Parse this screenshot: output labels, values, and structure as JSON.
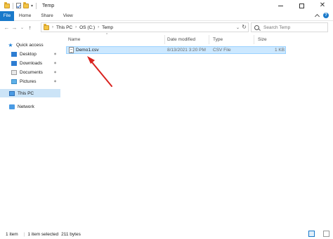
{
  "window": {
    "title": "Temp",
    "controls": {
      "minimize": "—",
      "maximize": "□",
      "close": "✕"
    }
  },
  "quick_access_toolbar": {
    "dropdown": "▾"
  },
  "ribbon": {
    "tabs": [
      "File",
      "Home",
      "Share",
      "View"
    ],
    "collapse_icon": "chevron-up-icon",
    "help_glyph": "?"
  },
  "navigation": {
    "back": "←",
    "forward": "→",
    "recent": "⌄",
    "up": "↑",
    "breadcrumb": [
      "This PC",
      "OS (C:)",
      "Temp"
    ],
    "separator": "›",
    "address_dropdown": "⌄",
    "refresh": "↻",
    "search_placeholder": "Search Temp"
  },
  "sidebar": {
    "quick_access": "Quick access",
    "items": [
      {
        "label": "Desktop",
        "icon": "desktop-icon",
        "pinned": true
      },
      {
        "label": "Downloads",
        "icon": "downloads-icon",
        "pinned": true
      },
      {
        "label": "Documents",
        "icon": "documents-icon",
        "pinned": true
      },
      {
        "label": "Pictures",
        "icon": "pictures-icon",
        "pinned": true
      }
    ],
    "this_pc": "This PC",
    "network": "Network",
    "pin_glyph": "✶"
  },
  "file_list": {
    "columns": [
      "Name",
      "Date modified",
      "Type",
      "Size"
    ],
    "sort_indicator": "^",
    "rows": [
      {
        "name": "Demo1.csv",
        "date_modified": "8/13/2021 3:20 PM",
        "type": "CSV File",
        "size": "1 KB",
        "selected": true
      }
    ]
  },
  "status_bar": {
    "item_count": "1 item",
    "selection": "1 item selected",
    "size": "211 bytes"
  },
  "colors": {
    "accent": "#1979ca",
    "selection_fill": "#cce8ff",
    "annotation_arrow": "#d9231f"
  }
}
